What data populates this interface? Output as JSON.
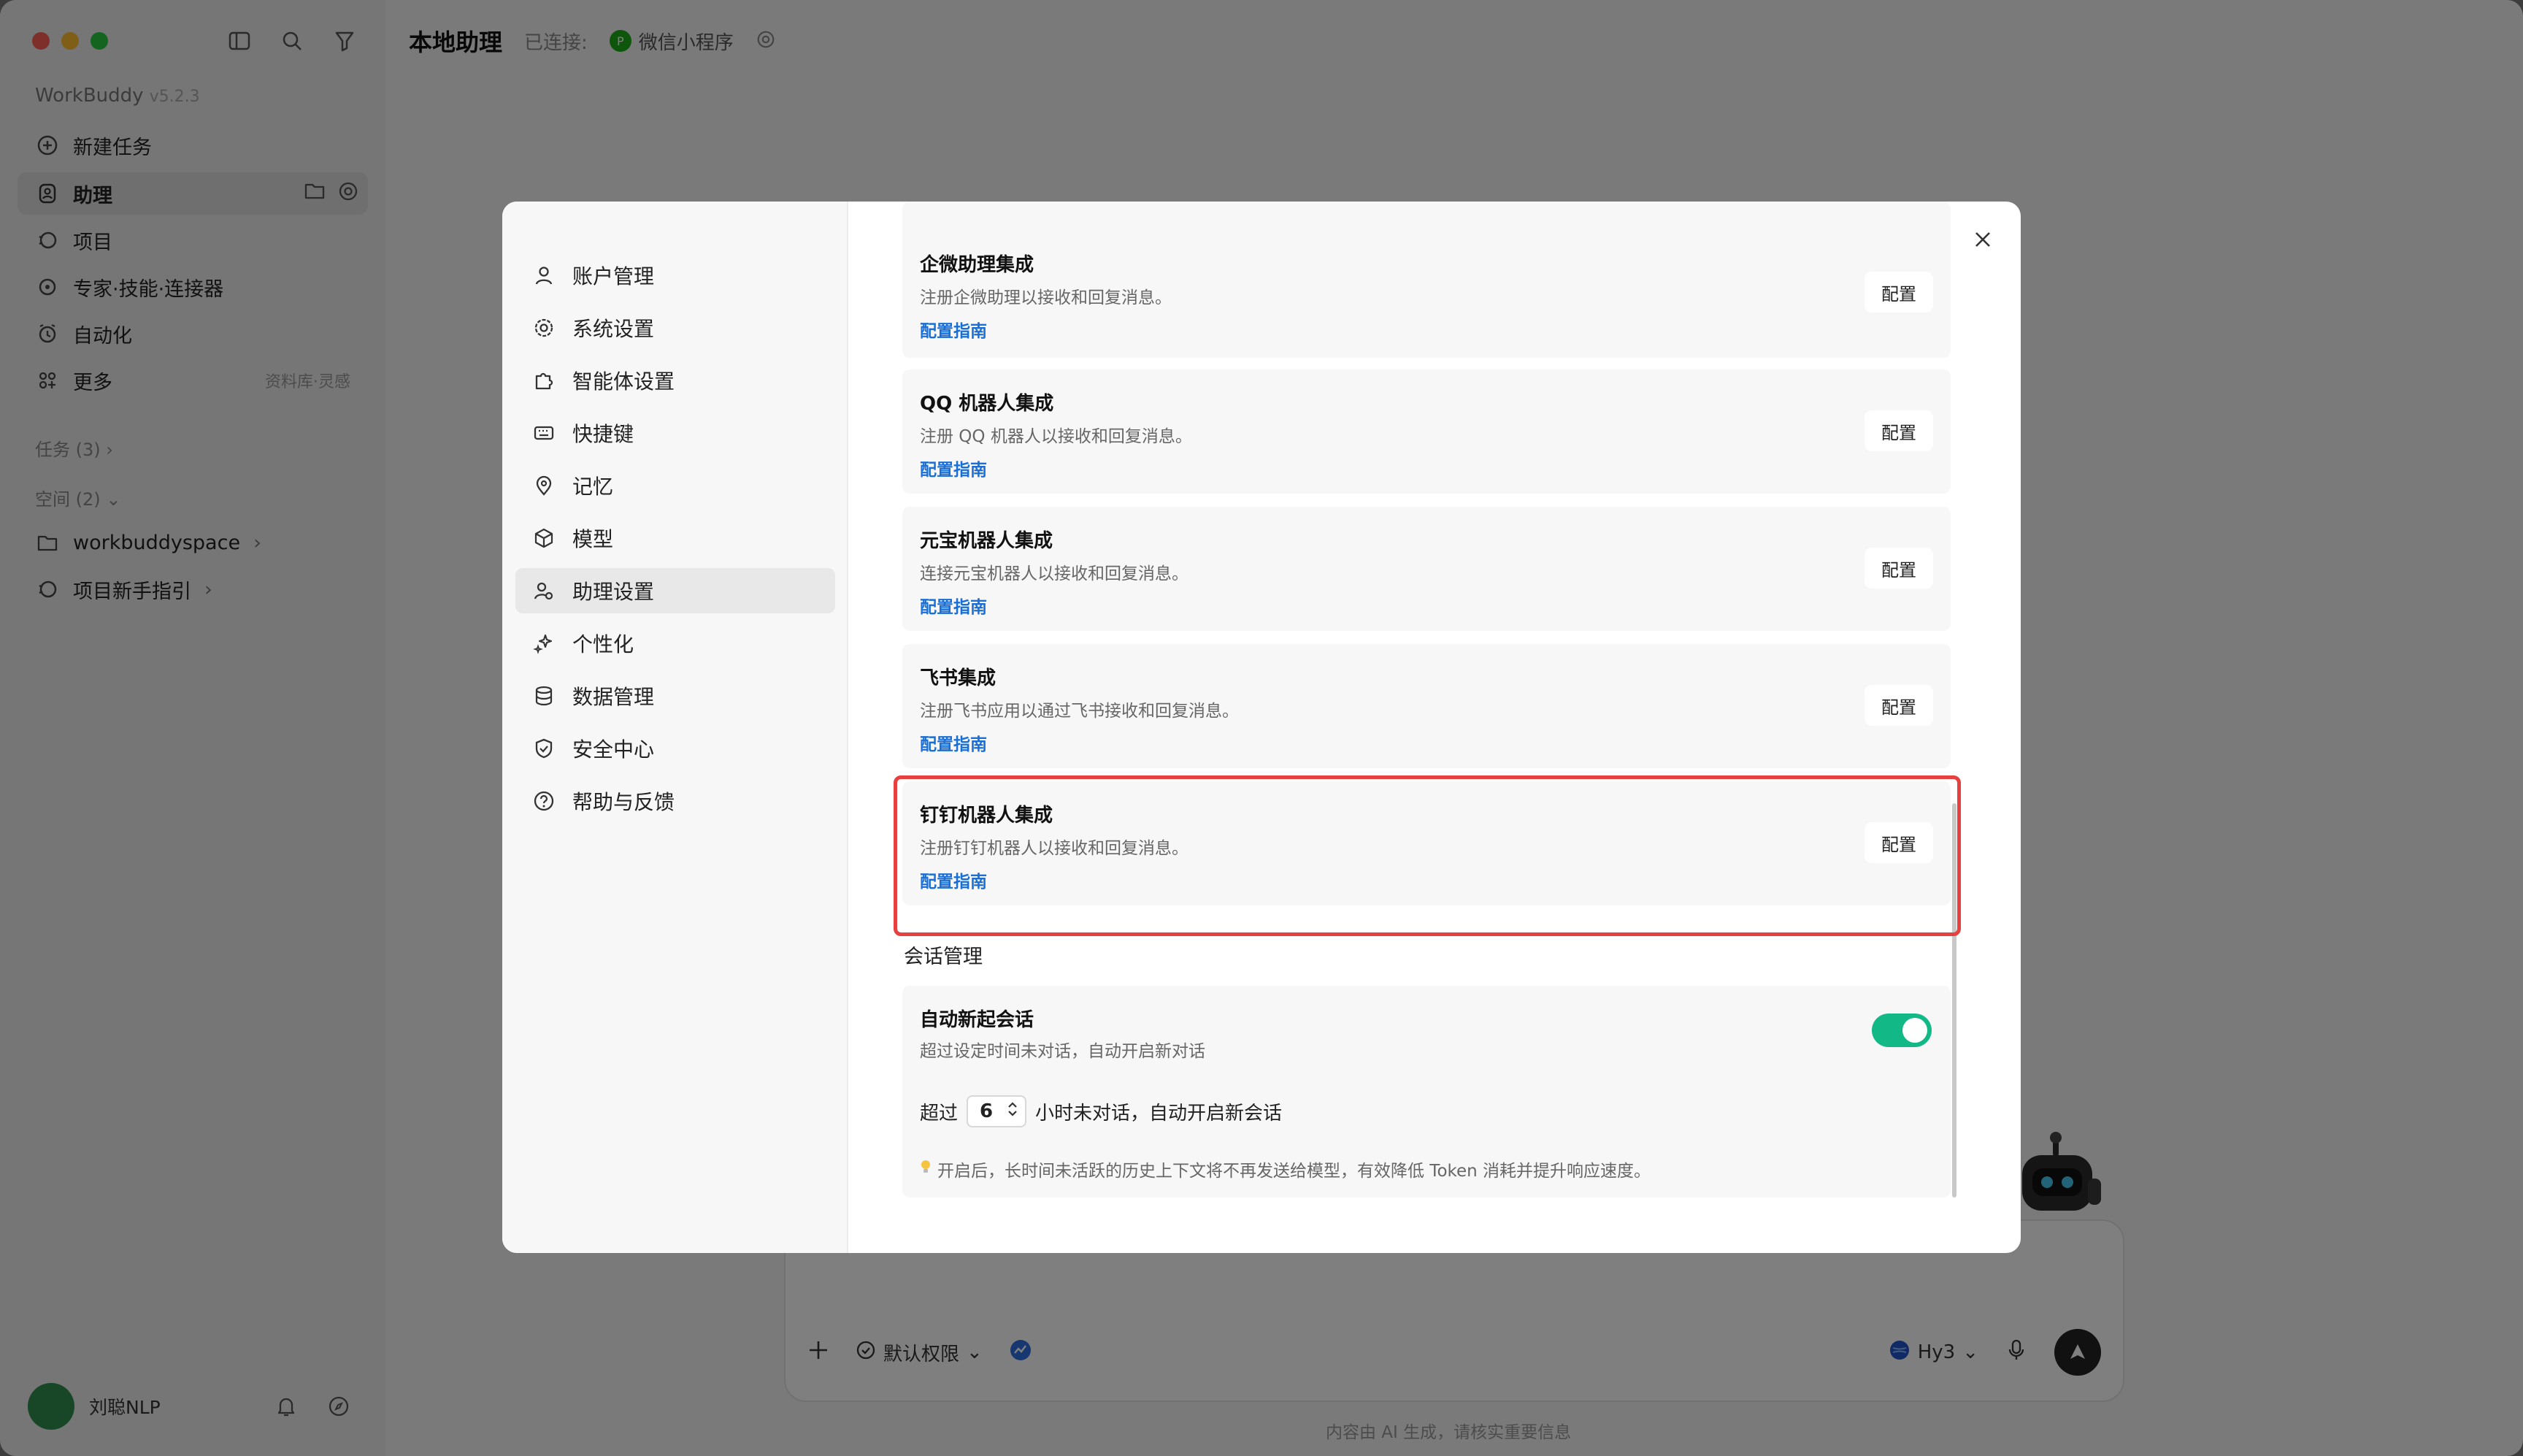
{
  "app": {
    "brand_name": "WorkBuddy",
    "version": "v5.2.3",
    "header_title": "本地助理",
    "connected_label": "已连接:",
    "connected_service": "微信小程序"
  },
  "sidebar": {
    "items": [
      {
        "label": "新建任务"
      },
      {
        "label": "助理"
      },
      {
        "label": "项目"
      },
      {
        "label": "专家·技能·连接器"
      },
      {
        "label": "自动化"
      },
      {
        "label": "更多",
        "hint": "资料库·灵感"
      }
    ],
    "tasks_label": "任务 (3)",
    "spaces_label": "空间 (2)",
    "spaces": [
      {
        "label": "workbuddyspace"
      },
      {
        "label": "项目新手指引"
      }
    ],
    "user_name": "刘聪NLP"
  },
  "composer": {
    "permission_label": "默认权限",
    "model_label": "Hy3",
    "footer_note": "内容由 AI 生成，请核实重要信息"
  },
  "settings": {
    "nav": [
      {
        "label": "账户管理"
      },
      {
        "label": "系统设置"
      },
      {
        "label": "智能体设置"
      },
      {
        "label": "快捷键"
      },
      {
        "label": "记忆"
      },
      {
        "label": "模型"
      },
      {
        "label": "助理设置"
      },
      {
        "label": "个性化"
      },
      {
        "label": "数据管理"
      },
      {
        "label": "安全中心"
      },
      {
        "label": "帮助与反馈"
      }
    ],
    "integrations": [
      {
        "title": "企微助理集成",
        "desc": "注册企微助理以接收和回复消息。",
        "link": "配置指南",
        "button": "配置"
      },
      {
        "title": "QQ 机器人集成",
        "desc": "注册 QQ 机器人以接收和回复消息。",
        "link": "配置指南",
        "button": "配置"
      },
      {
        "title": "元宝机器人集成",
        "desc": "连接元宝机器人以接收和回复消息。",
        "link": "配置指南",
        "button": "配置"
      },
      {
        "title": "飞书集成",
        "desc": "注册飞书应用以通过飞书接收和回复消息。",
        "link": "配置指南",
        "button": "配置"
      },
      {
        "title": "钉钉机器人集成",
        "desc": "注册钉钉机器人以接收和回复消息。",
        "link": "配置指南",
        "button": "配置"
      }
    ],
    "session": {
      "section_title": "会话管理",
      "auto_title": "自动新起会话",
      "auto_desc": "超过设定时间未对话，自动开启新对话",
      "auto_enabled": true,
      "hours_prefix": "超过",
      "hours_value": "6",
      "hours_suffix": "小时未对话，自动开启新会话",
      "tip": "开启后，长时间未活跃的历史上下文将不再发送给模型，有效降低 Token 消耗并提升响应速度。"
    }
  },
  "colors": {
    "accent_green": "#12b886",
    "link_blue": "#1a6fd6",
    "highlight_red": "#e6403f"
  }
}
